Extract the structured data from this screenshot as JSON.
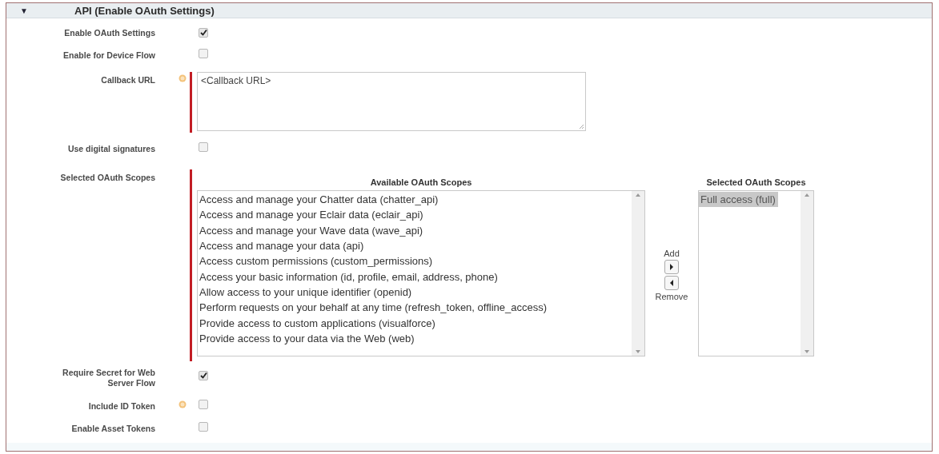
{
  "section": {
    "toggle": "▼",
    "title": "API (Enable OAuth Settings)"
  },
  "fields": [
    {
      "kind": "checkbox",
      "label": "Enable OAuth Settings",
      "checked": true
    },
    {
      "kind": "checkbox",
      "label": "Enable for Device Flow",
      "checked": false
    },
    {
      "kind": "textarea",
      "label": "Callback URL",
      "info": true,
      "required": true,
      "value": "<Callback URL>"
    },
    {
      "kind": "checkbox",
      "label": "Use digital signatures",
      "checked": false
    },
    {
      "kind": "scopes",
      "label": "Selected OAuth Scopes",
      "required": true,
      "available": {
        "heading": "Available OAuth Scopes",
        "options": [
          {
            "label": "Access and manage your Chatter data (chatter_api)",
            "selected": false
          },
          {
            "label": "Access and manage your Eclair data (eclair_api)",
            "selected": false
          },
          {
            "label": "Access and manage your Wave data (wave_api)",
            "selected": false
          },
          {
            "label": "Access and manage your data (api)",
            "selected": false
          },
          {
            "label": "Access custom permissions (custom_permissions)",
            "selected": false
          },
          {
            "label": "Access your basic information (id, profile, email, address, phone)",
            "selected": false
          },
          {
            "label": "Allow access to your unique identifier (openid)",
            "selected": false
          },
          {
            "label": "Perform requests on your behalf at any time (refresh_token, offline_access)",
            "selected": false
          },
          {
            "label": "Provide access to custom applications (visualforce)",
            "selected": false
          },
          {
            "label": "Provide access to your data via the Web (web)",
            "selected": false
          }
        ]
      },
      "add_label": "Add",
      "remove_label": "Remove",
      "selected": {
        "heading": "Selected OAuth Scopes",
        "options": [
          {
            "label": "Full access (full)",
            "selected": true
          }
        ]
      }
    },
    {
      "kind": "checkbox",
      "label": "Require Secret for Web Server Flow",
      "checked": true
    },
    {
      "kind": "checkbox",
      "label": "Include ID Token",
      "info": true,
      "checked": false
    },
    {
      "kind": "checkbox",
      "label": "Enable Asset Tokens",
      "checked": false
    }
  ]
}
